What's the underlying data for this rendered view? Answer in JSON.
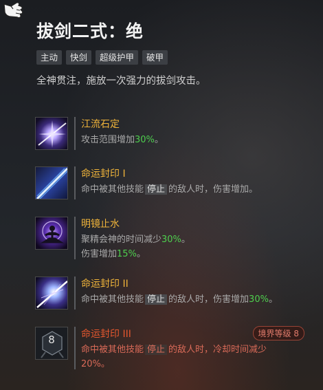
{
  "skill": {
    "title": "拔剑二式：绝",
    "tags": [
      "主动",
      "快剑",
      "超级护甲",
      "破甲"
    ],
    "description": "全神贯注，施放一次强力的拔剑攻击。"
  },
  "talents": [
    {
      "name": "江流石定",
      "icon": "burst-icon",
      "desc_pre": "攻击范围增加",
      "desc_value": "30%",
      "desc_post": "。"
    },
    {
      "name": "命运封印 I",
      "icon": "sword-streak-icon",
      "desc_pre": "命中被其他技能",
      "desc_chip": "停止",
      "desc_post": "的敌人时，伤害增加。"
    },
    {
      "name": "明镜止水",
      "icon": "meditation-icon",
      "line1_pre": "聚精会神的时间减少",
      "line1_value": "30%",
      "line1_post": "。",
      "line2_pre": "伤害增加",
      "line2_value": "15%",
      "line2_post": "。"
    },
    {
      "name": "命运封印 II",
      "icon": "sword-burst-icon",
      "desc_pre": "命中被其他技能",
      "desc_chip": "停止",
      "desc_mid": "的敌人时，伤害增加",
      "desc_value": "30%",
      "desc_post": "。"
    },
    {
      "name": "命运封印 III",
      "icon": "locked-rank-icon",
      "icon_number": "8",
      "rank_badge": "境界等级 8",
      "line1_pre": "命中被其他技能",
      "line1_chip": "停止",
      "line1_post": "的敌人时，冷却时间减少",
      "line2": "20%。"
    }
  ],
  "colors": {
    "talent_name": "#f0b43a",
    "highlight": "#4ecf4e",
    "locked": "#e4572e"
  }
}
